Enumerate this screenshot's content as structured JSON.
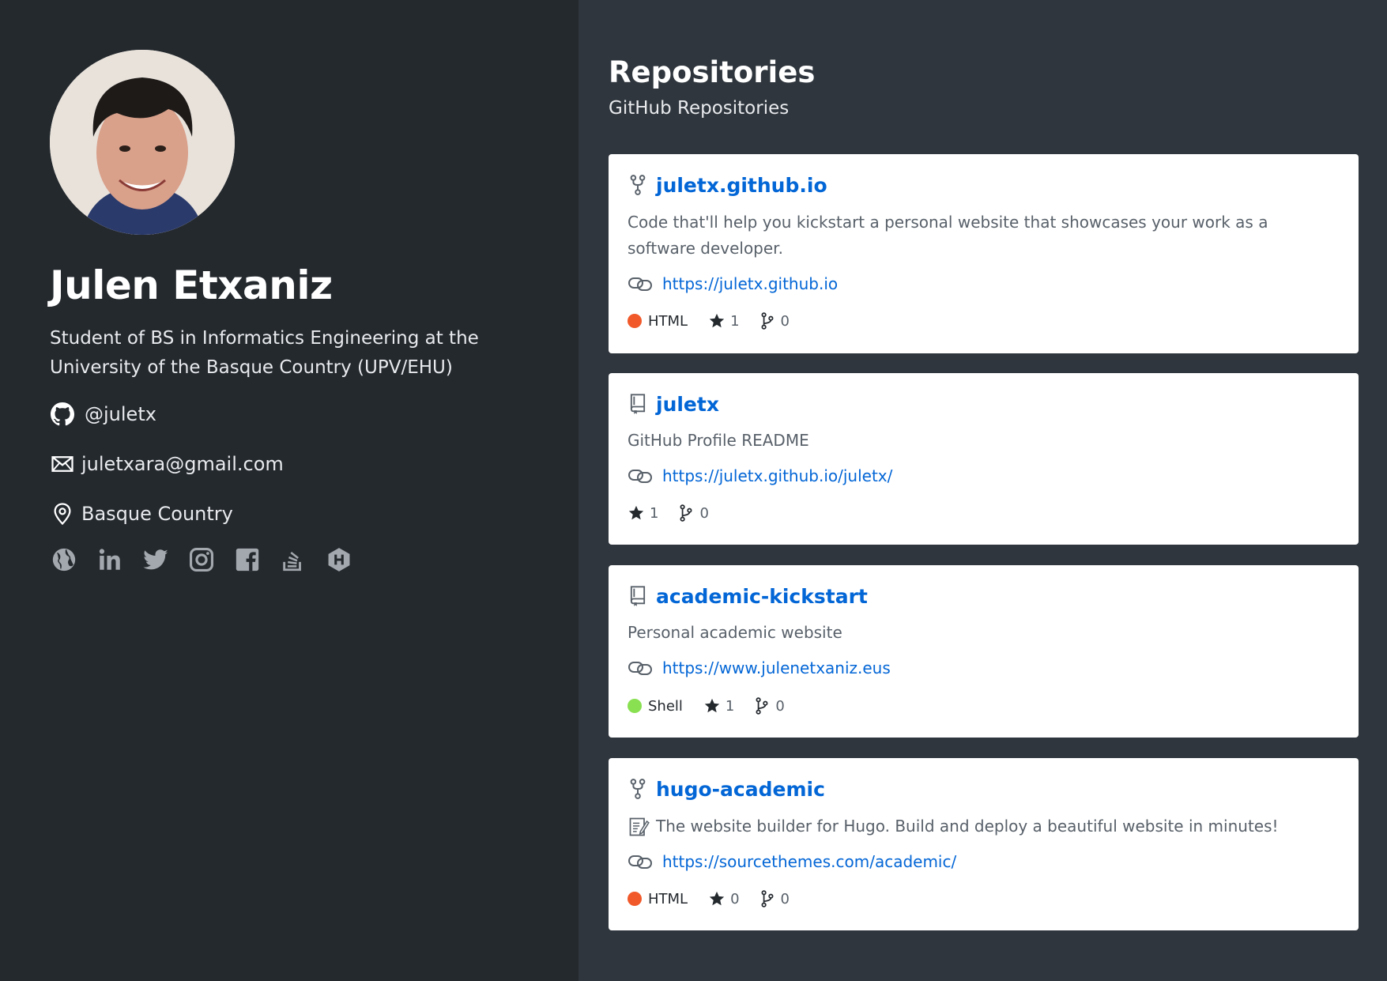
{
  "profile": {
    "name": "Julen Etxaniz",
    "bio": "Student of BS in Informatics Engineering at the University of the Basque Country (UPV/EHU)",
    "github": "@juletx",
    "email": "juletxara@gmail.com",
    "location": "Basque Country",
    "social_icons": [
      "globe-icon",
      "linkedin-icon",
      "twitter-icon",
      "instagram-icon",
      "facebook-icon",
      "stackoverflow-icon",
      "hackerrank-icon"
    ]
  },
  "repositories": {
    "title": "Repositories",
    "subtitle": "GitHub Repositories",
    "items": [
      {
        "name": "juletx.github.io",
        "icon": "fork-icon",
        "description": "Code that'll help you kickstart a personal website that showcases your work as a software developer.",
        "url": "https://juletx.github.io",
        "language": "HTML",
        "language_color": "#f1592a",
        "stars": "1",
        "forks": "0"
      },
      {
        "name": "juletx",
        "icon": "repo-book-icon",
        "description": "GitHub Profile README",
        "url": "https://juletx.github.io/juletx/",
        "language": "",
        "language_color": "",
        "stars": "1",
        "forks": "0"
      },
      {
        "name": "academic-kickstart",
        "icon": "repo-book-icon",
        "description": "Personal academic website",
        "url": "https://www.julenetxaniz.eus",
        "language": "Shell",
        "language_color": "#89e051",
        "stars": "1",
        "forks": "0"
      },
      {
        "name": "hugo-academic",
        "icon": "fork-icon",
        "description": "The website builder for Hugo. Build and deploy a beautiful website in minutes!",
        "url": "https://sourcethemes.com/academic/",
        "language": "HTML",
        "language_color": "#f1592a",
        "stars": "0",
        "forks": "0"
      }
    ]
  }
}
